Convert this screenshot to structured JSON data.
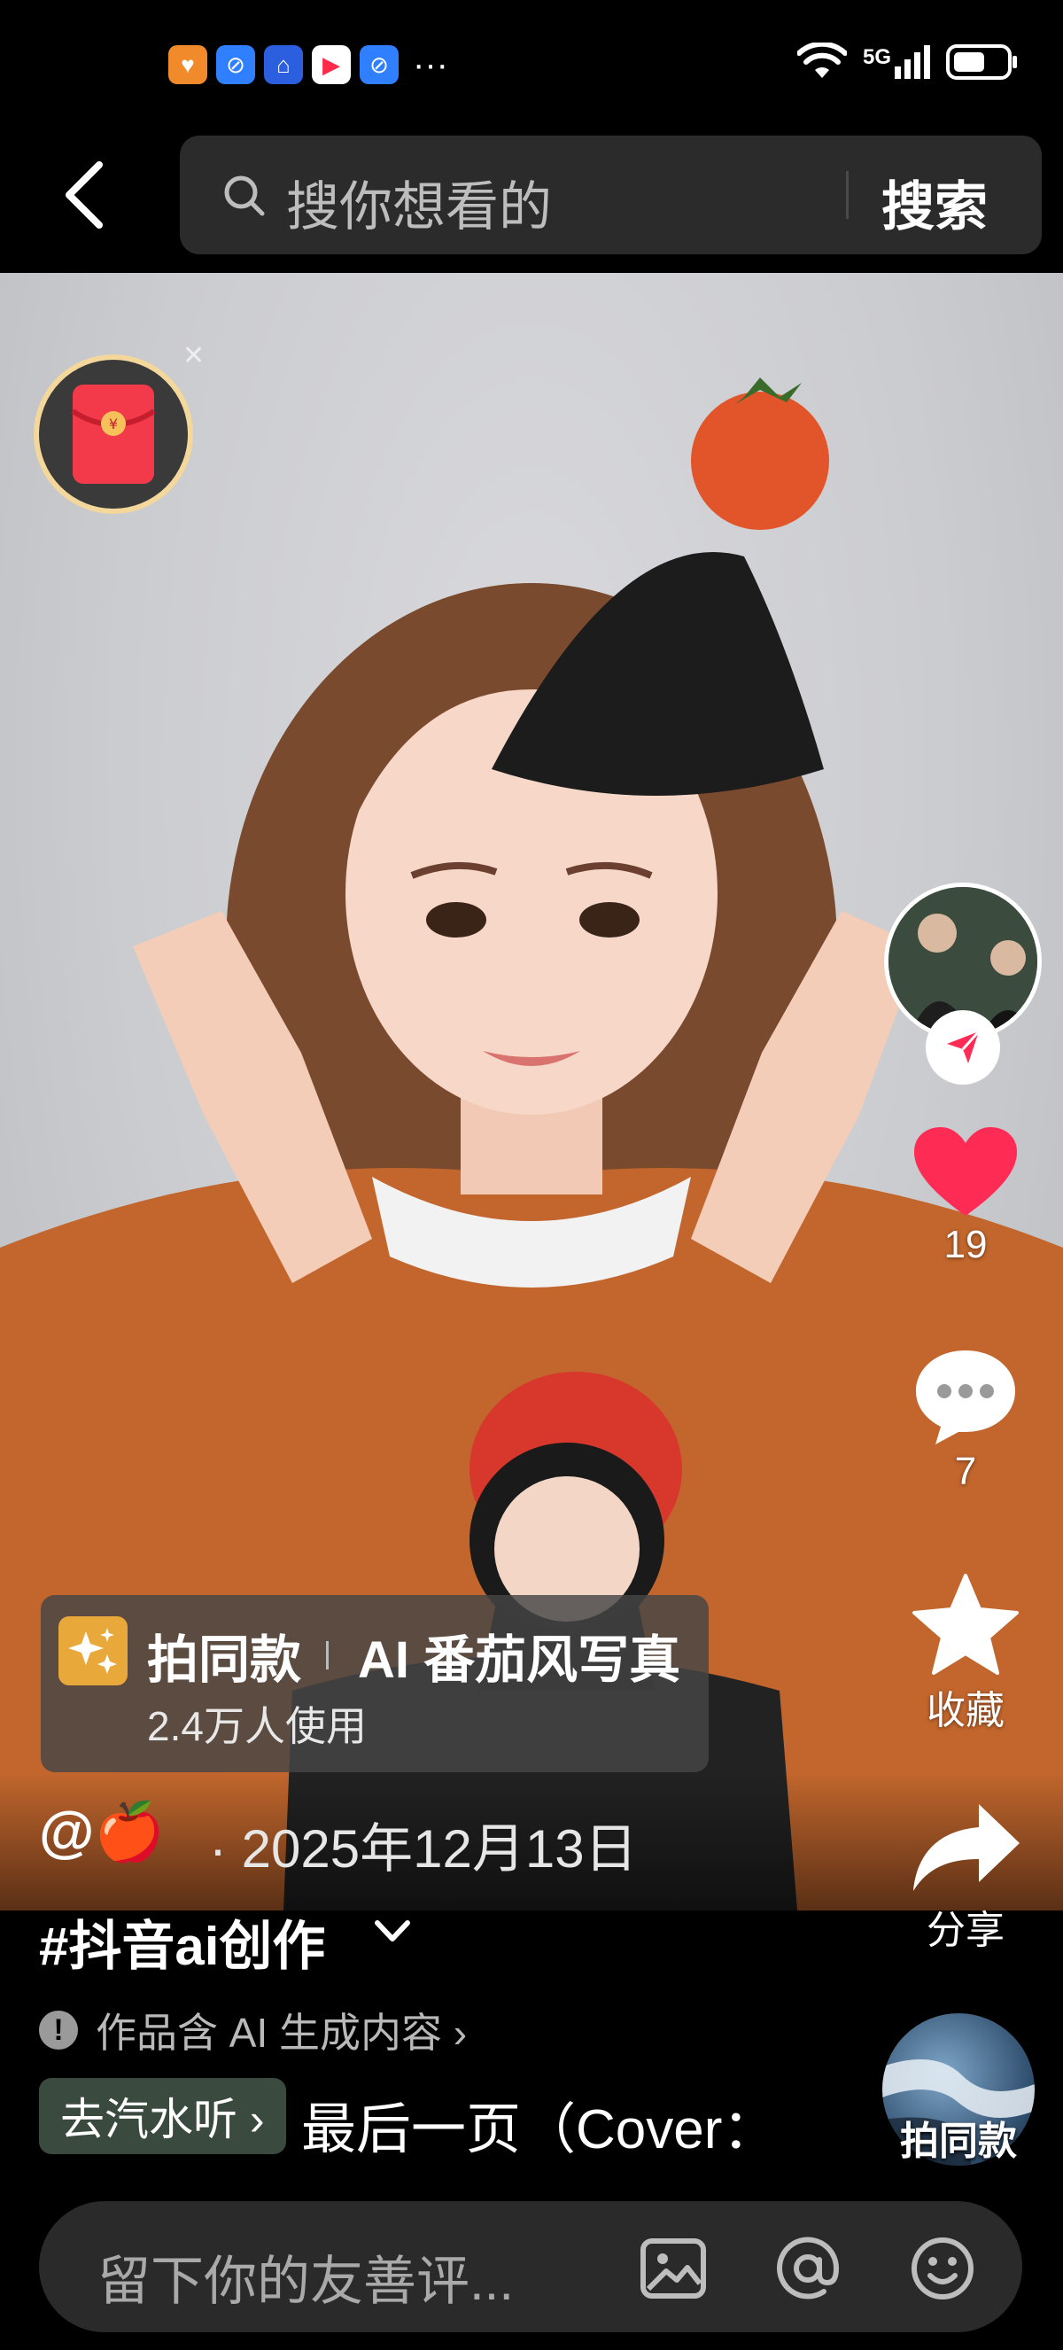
{
  "status_bar": {
    "network": "5G",
    "more": "···"
  },
  "search": {
    "placeholder": "搜你想看的",
    "button": "搜索"
  },
  "right_rail": {
    "like_count": "19",
    "comment_count": "7",
    "favorite_label": "收藏",
    "share_label": "分享"
  },
  "same_style": {
    "label": "拍同款",
    "title": "AI 番茄风写真",
    "users": "2.4万人使用"
  },
  "post": {
    "author": "@🍎",
    "date": "· 2025年12月13日",
    "hashtag": "#抖音ai创作",
    "ai_notice": "作品含 AI 生成内容 ›",
    "music_chip": "去汽水听 ›",
    "song": "最后一页（Cover：",
    "same_disc_label": "拍同款"
  },
  "comment_bar": {
    "placeholder": "留下你的友善评..."
  },
  "colors": {
    "like_red": "#fe2c55",
    "follow_red": "#fe2c55",
    "red_packet_ring": "#f3d79b"
  }
}
